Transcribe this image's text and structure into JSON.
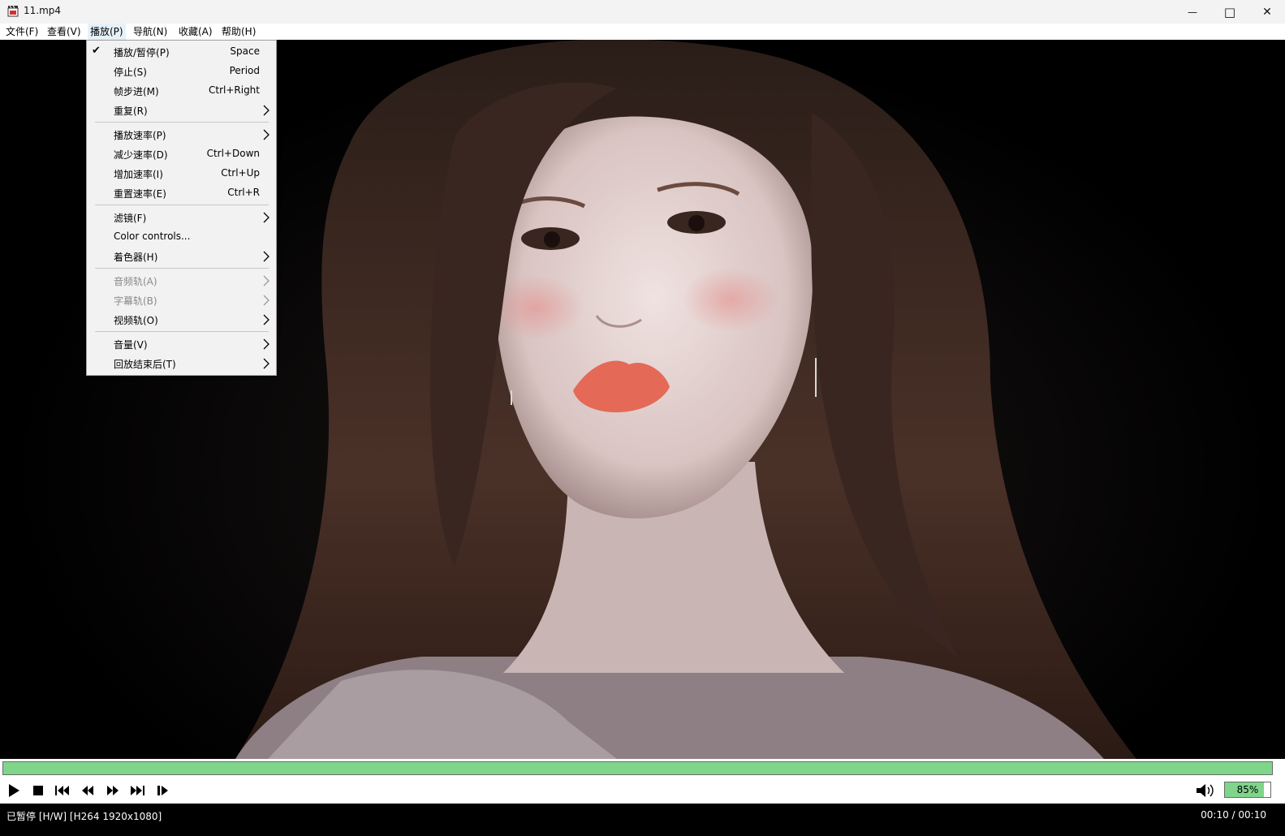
{
  "window": {
    "title": "11.mp4",
    "minimize_glyph": "—",
    "maximize_glyph": "□",
    "close_glyph": "✕"
  },
  "menubar": {
    "items": [
      {
        "label": "文件(F)"
      },
      {
        "label": "查看(V)"
      },
      {
        "label": "播放(P)"
      },
      {
        "label": "导航(N)"
      },
      {
        "label": "收藏(A)"
      },
      {
        "label": "帮助(H)"
      }
    ],
    "active_index": 2
  },
  "play_menu": {
    "items": [
      {
        "label": "播放/暂停(P)",
        "shortcut": "Space",
        "checked": true,
        "check_glyph": "✔"
      },
      {
        "label": "停止(S)",
        "shortcut": "Period"
      },
      {
        "label": "帧步进(M)",
        "shortcut": "Ctrl+Right"
      },
      {
        "label": "重复(R)",
        "submenu": true
      },
      {
        "label": "播放速率(P)",
        "submenu": true
      },
      {
        "label": "减少速率(D)",
        "shortcut": "Ctrl+Down"
      },
      {
        "label": "增加速率(I)",
        "shortcut": "Ctrl+Up"
      },
      {
        "label": "重置速率(E)",
        "shortcut": "Ctrl+R"
      },
      {
        "label": "滤镜(F)",
        "submenu": true
      },
      {
        "label": "Color controls..."
      },
      {
        "label": "着色器(H)",
        "submenu": true
      },
      {
        "label": "音频轨(A)",
        "submenu": true,
        "disabled": true
      },
      {
        "label": "字幕轨(B)",
        "submenu": true,
        "disabled": true
      },
      {
        "label": "视频轨(O)",
        "submenu": true
      },
      {
        "label": "音量(V)",
        "submenu": true
      },
      {
        "label": "回放结束后(T)",
        "submenu": true
      }
    ]
  },
  "player": {
    "seek_progress": 1.0,
    "volume_percent": 85,
    "volume_label": "85%",
    "colors": {
      "accent": "#7fd58a",
      "status_bg": "#000000"
    }
  },
  "icons": {
    "play": "play-icon",
    "stop": "stop-icon",
    "skip_back": "skip-back-icon",
    "rewind": "rewind-icon",
    "fast_forward": "fast-forward-icon",
    "skip_forward": "skip-forward-icon",
    "frame_step": "frame-step-icon",
    "volume": "speaker-icon"
  },
  "status": {
    "left": "已暂停 [H/W] [H264 1920x1080]",
    "right": "00:10 / 00:10"
  }
}
